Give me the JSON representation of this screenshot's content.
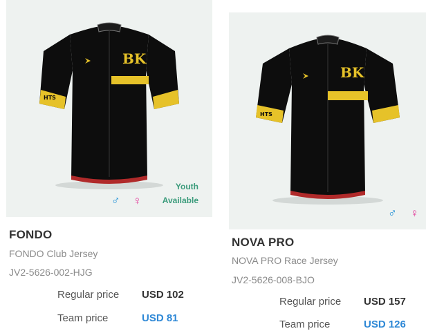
{
  "products": [
    {
      "name": "FONDO",
      "subtitle": "FONDO Club Jersey",
      "code": "JV2-5626-002-HJG",
      "regular_label": "Regular price",
      "regular_price": "USD 102",
      "team_label": "Team price",
      "team_price": "USD 81",
      "badge": [
        "Youth",
        "Available"
      ],
      "gender_icons": [
        "♂",
        "♀"
      ]
    },
    {
      "name": "NOVA PRO",
      "subtitle": "NOVA PRO Race Jersey",
      "code": "JV2-5626-008-BJO",
      "regular_label": "Regular price",
      "regular_price": "USD 157",
      "team_label": "Team price",
      "team_price": "USD 126",
      "gender_icons": [
        "♂",
        "♀"
      ]
    }
  ],
  "jersey_art": {
    "logo_text": "BK",
    "sleeve_text_left_fondo": "HTS",
    "sleeve_text_left_nova": "HTS",
    "colors": {
      "body": "#0d0d0d",
      "accent": "#e6c229",
      "trim": "#b02a2a"
    }
  }
}
